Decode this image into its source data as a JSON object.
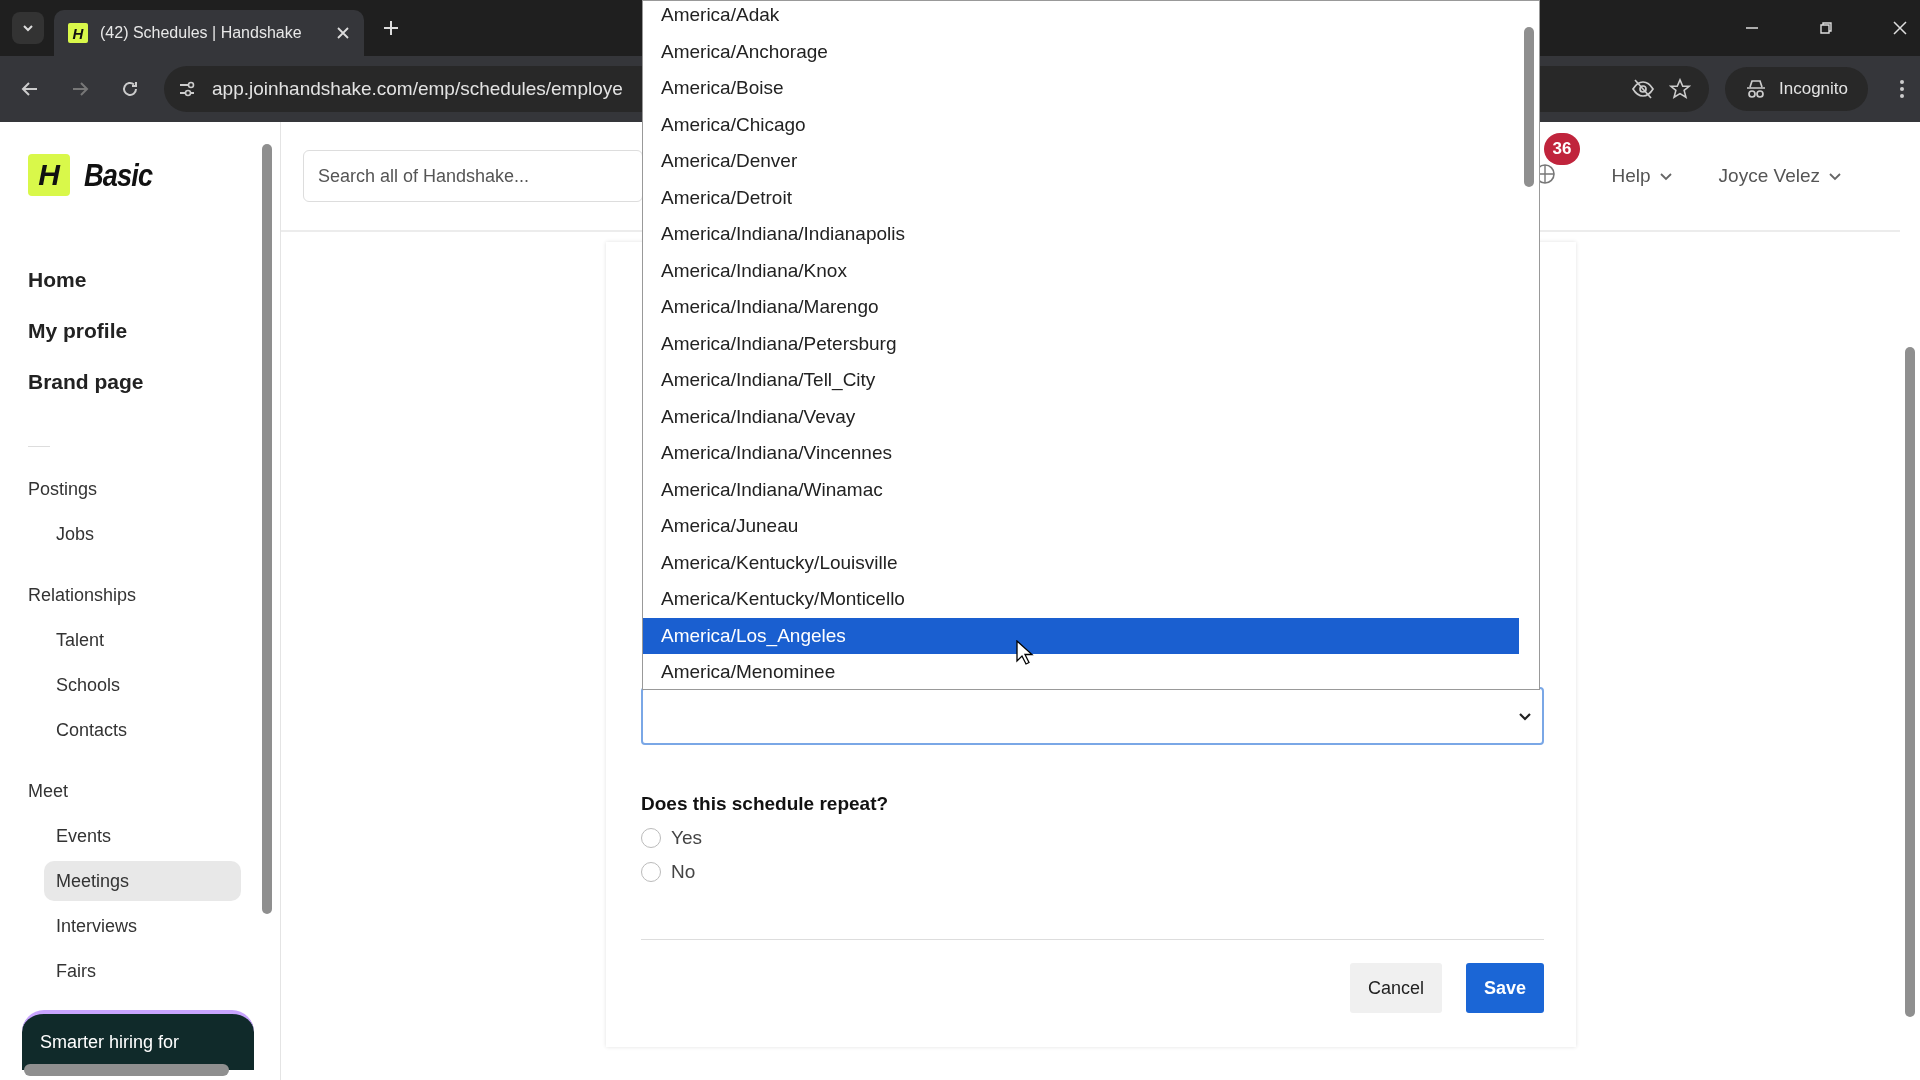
{
  "browser": {
    "tab_title": "(42) Schedules | Handshake",
    "favicon": "H",
    "url": "app.joinhandshake.com/emp/schedules/employe",
    "profile": "Incognito"
  },
  "sidebar": {
    "logo_letter": "H",
    "brand": "Basic",
    "primary": [
      "Home",
      "My profile",
      "Brand page"
    ],
    "sections": [
      {
        "title": "Postings",
        "items": [
          {
            "label": "Jobs",
            "selected": false
          }
        ]
      },
      {
        "title": "Relationships",
        "items": [
          {
            "label": "Talent",
            "selected": false
          },
          {
            "label": "Schools",
            "selected": false
          },
          {
            "label": "Contacts",
            "selected": false
          }
        ]
      },
      {
        "title": "Meet",
        "items": [
          {
            "label": "Events",
            "selected": false
          },
          {
            "label": "Meetings",
            "selected": true
          },
          {
            "label": "Interviews",
            "selected": false
          },
          {
            "label": "Fairs",
            "selected": false
          }
        ]
      }
    ],
    "promo": "Smarter hiring for"
  },
  "header": {
    "search": {
      "placeholder": "Search all of Handshake..."
    },
    "notification_count": "36",
    "menus": [
      "Help",
      "Joyce Velez"
    ]
  },
  "dropdown": {
    "options": [
      {
        "label": "America/Adak",
        "selected": false
      },
      {
        "label": "America/Anchorage",
        "selected": false
      },
      {
        "label": "America/Boise",
        "selected": false
      },
      {
        "label": "America/Chicago",
        "selected": false
      },
      {
        "label": "America/Denver",
        "selected": false
      },
      {
        "label": "America/Detroit",
        "selected": false
      },
      {
        "label": "America/Indiana/Indianapolis",
        "selected": false
      },
      {
        "label": "America/Indiana/Knox",
        "selected": false
      },
      {
        "label": "America/Indiana/Marengo",
        "selected": false
      },
      {
        "label": "America/Indiana/Petersburg",
        "selected": false
      },
      {
        "label": "America/Indiana/Tell_City",
        "selected": false
      },
      {
        "label": "America/Indiana/Vevay",
        "selected": false
      },
      {
        "label": "America/Indiana/Vincennes",
        "selected": false
      },
      {
        "label": "America/Indiana/Winamac",
        "selected": false
      },
      {
        "label": "America/Juneau",
        "selected": false
      },
      {
        "label": "America/Kentucky/Louisville",
        "selected": false
      },
      {
        "label": "America/Kentucky/Monticello",
        "selected": false
      },
      {
        "label": "America/Los_Angeles",
        "selected": true
      },
      {
        "label": "America/Menominee",
        "selected": false
      }
    ]
  },
  "form": {
    "question": "Does this schedule repeat?",
    "options": [
      {
        "label": "Yes",
        "selected": false
      },
      {
        "label": "No",
        "selected": false
      }
    ],
    "buttons": [
      {
        "label": "Cancel",
        "kind": "secondary"
      },
      {
        "label": "Save",
        "kind": "primary"
      }
    ]
  }
}
